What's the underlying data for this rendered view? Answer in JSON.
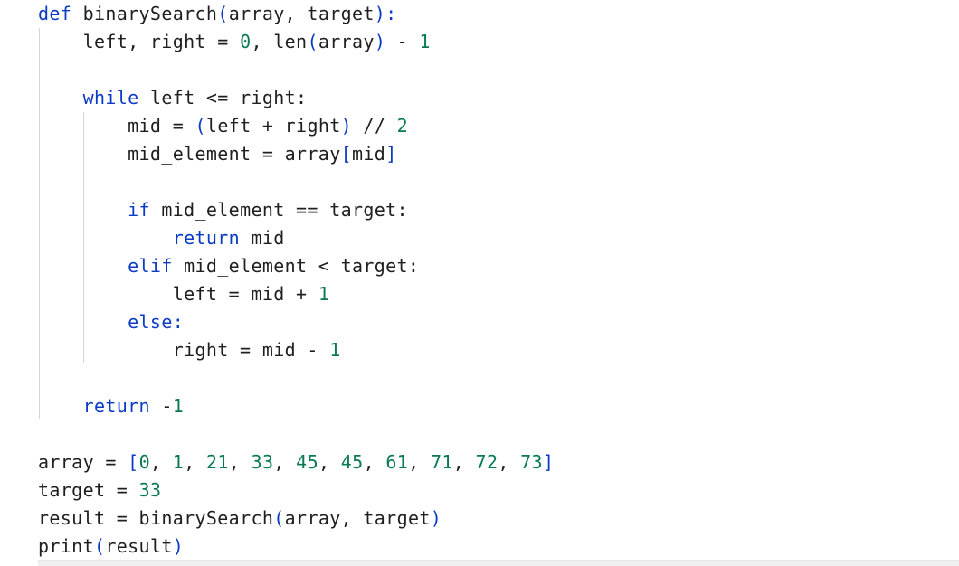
{
  "editor": {
    "lines": [
      [
        {
          "t": "def",
          "c": "kw"
        },
        {
          "t": " binarySearch",
          "c": "plain"
        },
        {
          "t": "(",
          "c": "pn"
        },
        {
          "t": "array, target",
          "c": "plain"
        },
        {
          "t": "):",
          "c": "pn"
        }
      ],
      [
        {
          "t": "    left, right ",
          "c": "plain"
        },
        {
          "t": "=",
          "c": "op"
        },
        {
          "t": " ",
          "c": "plain"
        },
        {
          "t": "0",
          "c": "num"
        },
        {
          "t": ", len",
          "c": "plain"
        },
        {
          "t": "(",
          "c": "pn"
        },
        {
          "t": "array",
          "c": "plain"
        },
        {
          "t": ")",
          "c": "pn"
        },
        {
          "t": " - ",
          "c": "op"
        },
        {
          "t": "1",
          "c": "num"
        }
      ],
      [],
      [
        {
          "t": "    ",
          "c": "plain"
        },
        {
          "t": "while",
          "c": "kw"
        },
        {
          "t": " left <= right:",
          "c": "plain"
        }
      ],
      [
        {
          "t": "        mid ",
          "c": "plain"
        },
        {
          "t": "=",
          "c": "op"
        },
        {
          "t": " ",
          "c": "plain"
        },
        {
          "t": "(",
          "c": "pn"
        },
        {
          "t": "left + right",
          "c": "plain"
        },
        {
          "t": ")",
          "c": "pn"
        },
        {
          "t": " // ",
          "c": "plain"
        },
        {
          "t": "2",
          "c": "num"
        }
      ],
      [
        {
          "t": "        mid_element ",
          "c": "plain"
        },
        {
          "t": "=",
          "c": "op"
        },
        {
          "t": " array",
          "c": "plain"
        },
        {
          "t": "[",
          "c": "pn"
        },
        {
          "t": "mid",
          "c": "plain"
        },
        {
          "t": "]",
          "c": "pn"
        }
      ],
      [],
      [
        {
          "t": "        ",
          "c": "plain"
        },
        {
          "t": "if",
          "c": "kw"
        },
        {
          "t": " mid_element == target:",
          "c": "plain"
        }
      ],
      [
        {
          "t": "            ",
          "c": "plain"
        },
        {
          "t": "return",
          "c": "kw"
        },
        {
          "t": " mid",
          "c": "plain"
        }
      ],
      [
        {
          "t": "        ",
          "c": "plain"
        },
        {
          "t": "elif",
          "c": "kw"
        },
        {
          "t": " mid_element < target:",
          "c": "plain"
        }
      ],
      [
        {
          "t": "            left ",
          "c": "plain"
        },
        {
          "t": "=",
          "c": "op"
        },
        {
          "t": " mid + ",
          "c": "plain"
        },
        {
          "t": "1",
          "c": "num"
        }
      ],
      [
        {
          "t": "        ",
          "c": "plain"
        },
        {
          "t": "else",
          "c": "kw"
        },
        {
          "t": ":",
          "c": "pn"
        }
      ],
      [
        {
          "t": "            right ",
          "c": "plain"
        },
        {
          "t": "=",
          "c": "op"
        },
        {
          "t": " mid - ",
          "c": "plain"
        },
        {
          "t": "1",
          "c": "num"
        }
      ],
      [],
      [
        {
          "t": "    ",
          "c": "plain"
        },
        {
          "t": "return",
          "c": "kw"
        },
        {
          "t": " -",
          "c": "plain"
        },
        {
          "t": "1",
          "c": "num"
        }
      ],
      [],
      [
        {
          "t": "array ",
          "c": "plain"
        },
        {
          "t": "=",
          "c": "op"
        },
        {
          "t": " ",
          "c": "plain"
        },
        {
          "t": "[",
          "c": "pn"
        },
        {
          "t": "0",
          "c": "num"
        },
        {
          "t": ", ",
          "c": "plain"
        },
        {
          "t": "1",
          "c": "num"
        },
        {
          "t": ", ",
          "c": "plain"
        },
        {
          "t": "21",
          "c": "num"
        },
        {
          "t": ", ",
          "c": "plain"
        },
        {
          "t": "33",
          "c": "num"
        },
        {
          "t": ", ",
          "c": "plain"
        },
        {
          "t": "45",
          "c": "num"
        },
        {
          "t": ", ",
          "c": "plain"
        },
        {
          "t": "45",
          "c": "num"
        },
        {
          "t": ", ",
          "c": "plain"
        },
        {
          "t": "61",
          "c": "num"
        },
        {
          "t": ", ",
          "c": "plain"
        },
        {
          "t": "71",
          "c": "num"
        },
        {
          "t": ", ",
          "c": "plain"
        },
        {
          "t": "72",
          "c": "num"
        },
        {
          "t": ", ",
          "c": "plain"
        },
        {
          "t": "73",
          "c": "num"
        },
        {
          "t": "]",
          "c": "pn"
        }
      ],
      [
        {
          "t": "target ",
          "c": "plain"
        },
        {
          "t": "=",
          "c": "op"
        },
        {
          "t": " ",
          "c": "plain"
        },
        {
          "t": "33",
          "c": "num"
        }
      ],
      [
        {
          "t": "result ",
          "c": "plain"
        },
        {
          "t": "=",
          "c": "op"
        },
        {
          "t": " binarySearch",
          "c": "plain"
        },
        {
          "t": "(",
          "c": "pn"
        },
        {
          "t": "array, target",
          "c": "plain"
        },
        {
          "t": ")",
          "c": "pn"
        }
      ],
      [
        {
          "t": "print",
          "c": "plain"
        },
        {
          "t": "(",
          "c": "pn"
        },
        {
          "t": "result",
          "c": "plain"
        },
        {
          "t": ")",
          "c": "pn"
        }
      ]
    ]
  },
  "colors": {
    "keyword": "#0b3bc4",
    "text": "#1f1f1f",
    "number": "#097a54",
    "bracket": "#0b3bc4",
    "indent_guide": "#d6d6d6",
    "background": "#ffffff"
  }
}
